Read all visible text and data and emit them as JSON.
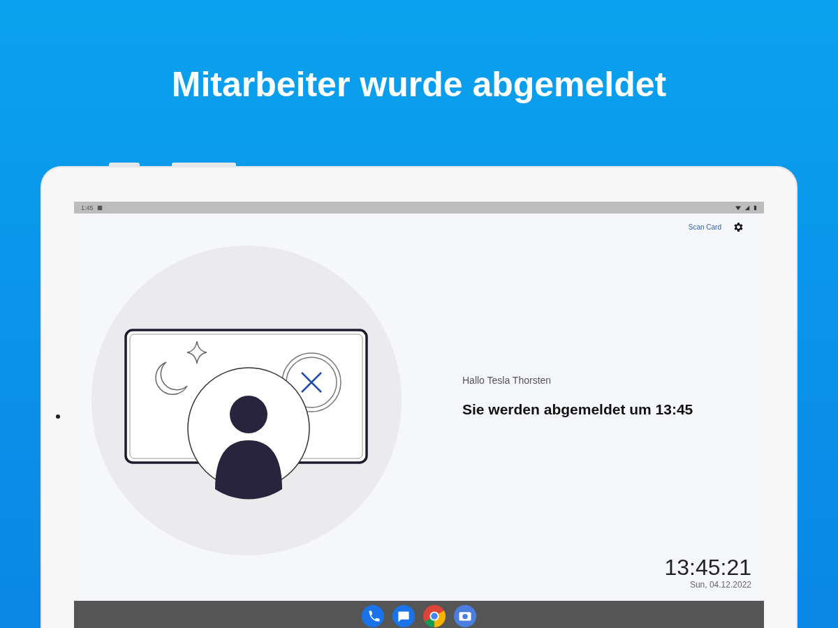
{
  "headline": "Mitarbeiter wurde abgemeldet",
  "status_bar": {
    "time": "1:45"
  },
  "toolbar": {
    "scan_link": "Scan Card"
  },
  "greeting": "Hallo Tesla Thorsten",
  "message": "Sie werden abgemeldet um 13:45",
  "clock": {
    "time": "13:45:21",
    "date": "Sun, 04.12.2022"
  }
}
